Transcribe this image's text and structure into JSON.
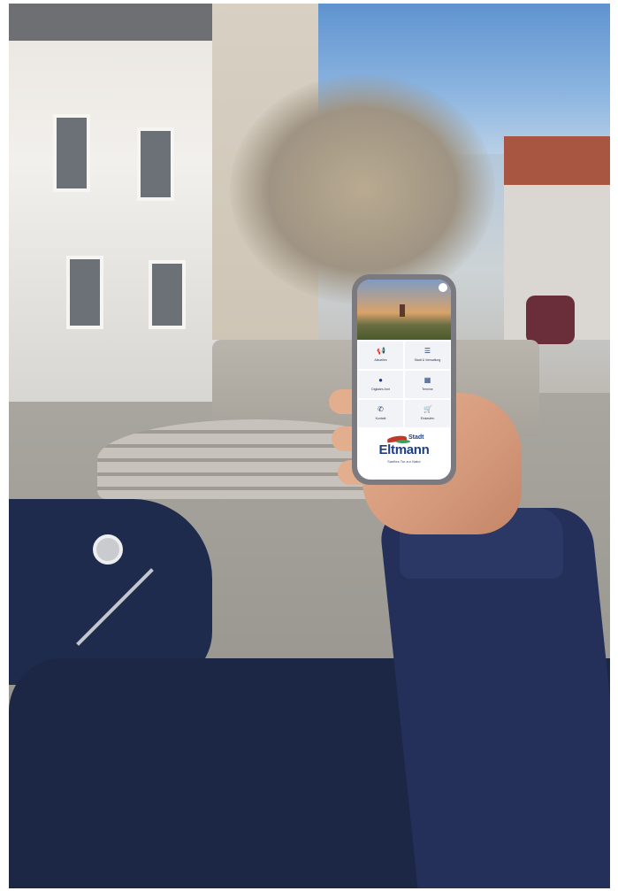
{
  "app": {
    "tiles": [
      {
        "label": "Aktuelles",
        "icon": "megaphone-icon",
        "glyph": "📢"
      },
      {
        "label": "Stadt & Verwaltung",
        "icon": "list-icon",
        "glyph": "☰"
      },
      {
        "label": "Digitales Amt",
        "icon": "globe-icon",
        "glyph": "●"
      },
      {
        "label": "Termine",
        "icon": "calendar-icon",
        "glyph": "▦"
      },
      {
        "label": "Kontakt",
        "icon": "phone-icon",
        "glyph": "✆"
      },
      {
        "label": "Einkaufen",
        "icon": "shopping-cart-icon",
        "glyph": "🛒"
      }
    ],
    "logo": {
      "prefix": "Stadt",
      "name": "Eltmann",
      "tagline": "Sanftes Tor zur Natur"
    }
  },
  "colors": {
    "brand_blue": "#1d3f87",
    "coat_navy": "#1f2b4d",
    "accent_red": "#c0392b",
    "accent_green": "#3aa15a"
  }
}
